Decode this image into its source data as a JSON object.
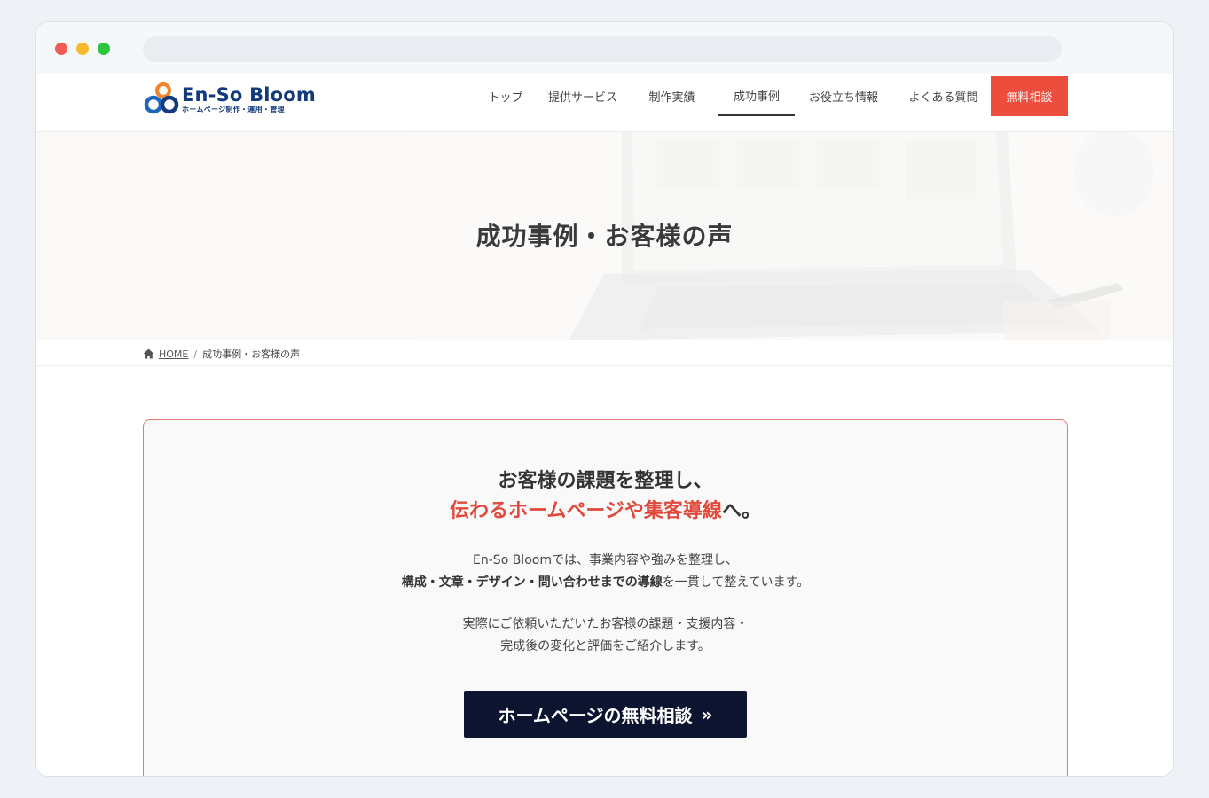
{
  "logo": {
    "title": "En-So Bloom",
    "subtitle": "ホームページ制作・運用・管理",
    "colors": {
      "orange": "#f0852b",
      "blue": "#1f67b8",
      "navy": "#133a7c"
    }
  },
  "nav": {
    "items": [
      {
        "label": "トップ",
        "active": false
      },
      {
        "label": "提供サービス",
        "active": false
      },
      {
        "label": "制作実績",
        "active": false
      },
      {
        "label": "成功事例",
        "active": true
      },
      {
        "label": "お役立ち情報",
        "active": false
      },
      {
        "label": "よくある質問",
        "active": false
      }
    ],
    "cta_label": "無料相談",
    "cta_color": "#ec4d3d"
  },
  "hero": {
    "title": "成功事例・お客様の声"
  },
  "breadcrumb": {
    "home_label": "HOME",
    "separator": "/",
    "current": "成功事例・お客様の声"
  },
  "card": {
    "headline_line1": "お客様の課題を整理し、",
    "headline_accent": "伝わるホームページや集客導線",
    "headline_tail": "へ。",
    "p1_line1": "En-So Bloomでは、事業内容や強みを整理し、",
    "p1_bold": "構成・文章・デザイン・問い合わせまでの導線",
    "p1_rest": "を一貫して整えています。",
    "p2_line1": "実際にご依頼いただいたお客様の課題・支援内容・",
    "p2_line2": "完成後の変化と評価をご紹介します。",
    "cta_label": "ホームページの無料相談",
    "cta_icon": "chevron-double-right-icon",
    "accent_color": "#e0493b",
    "cta_bg": "#0c1430"
  }
}
